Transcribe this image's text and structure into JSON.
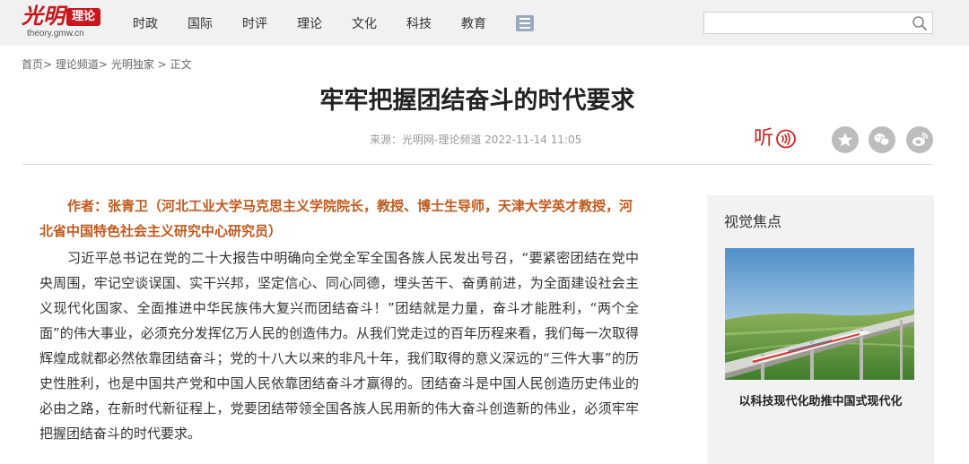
{
  "logo": {
    "script": "光明",
    "badge": "理论",
    "domain": "theory.gmw.cn"
  },
  "nav": {
    "items": [
      "时政",
      "国际",
      "时评",
      "理论",
      "文化",
      "科技",
      "教育"
    ]
  },
  "search": {
    "placeholder": "",
    "value": ""
  },
  "breadcrumb": {
    "home": "首页",
    "channel": "理论频道",
    "section": "光明独家",
    "current": "正文",
    "sep": ">"
  },
  "article": {
    "title": "牢牢把握团结奋斗的时代要求",
    "meta": "来源：光明网-理论频道  2022-11-14 11:05",
    "listen_label": "听",
    "author": "作者：张青卫（河北工业大学马克思主义学院院长，教授、博士生导师，天津大学英才教授，河北省中国特色社会主义研究中心研究员）",
    "paragraphs": [
      "习近平总书记在党的二十大报告中明确向全党全军全国各族人民发出号召，“要紧密团结在党中央周围，牢记空谈误国、实干兴邦，坚定信心、同心同德，埋头苦干、奋勇前进，为全面建设社会主义现代化国家、全面推进中华民族伟大复兴而团结奋斗！”团结就是力量，奋斗才能胜利，“两个全面”的伟大事业，必须充分发挥亿万人民的创造伟力。从我们党走过的百年历程来看，我们每一次取得辉煌成就都必然依靠团结奋斗；党的十八大以来的非凡十年，我们取得的意义深远的“三件大事”的历史性胜利，也是中国共产党和中国人民依靠团结奋斗才赢得的。团结奋斗是中国人民创造历史伟业的必由之路，在新时代新征程上，党要团结带领全国各族人民用新的伟大奋斗创造新的伟业，必须牢牢把握团结奋斗的时代要求。"
    ]
  },
  "share": {
    "icons": [
      "favorite-icon",
      "wechat-icon",
      "weibo-icon"
    ]
  },
  "sidebar": {
    "title": "视觉焦点",
    "caption": "以科技现代化助推中国式现代化"
  },
  "colors": {
    "brand_red": "#c8161d",
    "author_orange": "#c0591c",
    "topbar_bg": "#f1f1f1",
    "sidebar_bg": "#f2f2f2"
  }
}
